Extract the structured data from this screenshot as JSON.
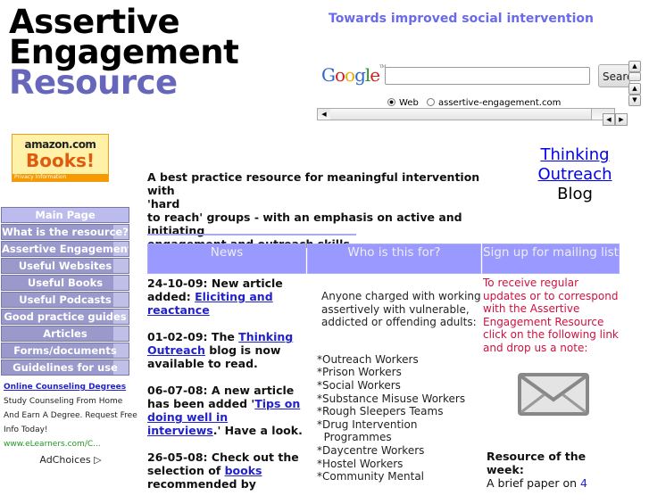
{
  "header": {
    "logo_lines": [
      "Assertive",
      "Engagement",
      "Resource"
    ],
    "tagline": "Towards improved social intervention"
  },
  "search": {
    "brand_letters": [
      "G",
      "o",
      "o",
      "g",
      "l",
      "e"
    ],
    "brand_tm": "TM",
    "input_value": "",
    "button_label": "Search",
    "radio_options": [
      {
        "label": "Web",
        "checked": true
      },
      {
        "label": "assertive-engagement.com",
        "checked": false
      }
    ]
  },
  "amazon_banner": {
    "brand": "amazon.com",
    "headline": "Books!",
    "footer": "Privacy Information"
  },
  "nav": {
    "items": [
      {
        "label": "Main Page"
      },
      {
        "label": "What is the resource?"
      },
      {
        "label": "Assertive Engagement"
      },
      {
        "label": "Useful Websites"
      },
      {
        "label": "Useful Books"
      },
      {
        "label": "Useful Podcasts"
      },
      {
        "label": "Good practice guides"
      },
      {
        "label": "Articles"
      },
      {
        "label": "Forms/documents"
      },
      {
        "label": "Guidelines for use"
      }
    ]
  },
  "ad": {
    "title": "Online Counseling Degrees",
    "body": "Study Counseling From Home And Earn A Degree. Request Free Info Today!",
    "url": "www.eLearners.com/C...",
    "choices_label": "AdChoices",
    "choices_icon": "▷"
  },
  "blog_link": {
    "line1": "Thinking",
    "line2": "Outreach",
    "suffix": "Blog"
  },
  "intro": {
    "line1": "A best practice resource for meaningful intervention with",
    "line2": "'hard",
    "line3": "to reach' groups - with an emphasis on active and initiating",
    "line4": "engagement and outreach skills"
  },
  "columns": {
    "news_header": "News",
    "who_header": "Who is this for?",
    "signup_header": "Sign up for mailing list"
  },
  "news": [
    {
      "prefix": "24-10-09: New article added: ",
      "link": "Eliciting and reactance",
      "suffix": ""
    },
    {
      "prefix": "01-02-09: The ",
      "link": "Thinking Outreach",
      "suffix": " blog is now available to read."
    },
    {
      "prefix": "06-07-08: A new article has been added '",
      "link": "Tips on doing well in interviews",
      "suffix": ".' Have a look."
    },
    {
      "prefix": "26-05-08: Check out the selection of ",
      "link": "books",
      "suffix": " recommended by"
    }
  ],
  "who": {
    "intro": "Anyone charged with working assertively with vulnerable, addicted or offending adults:",
    "roles": [
      "*Outreach Workers",
      "*Prison Workers",
      "*Social Workers",
      "*Substance Misuse Workers",
      "*Rough Sleepers Teams",
      "*Drug Intervention",
      "  Programmes",
      "*Daycentre Workers",
      "*Hostel Workers",
      "*Community Mental"
    ]
  },
  "signup": {
    "text": "To receive regular updates or to correspond with the Assertive Engagement Resource click on the following link and drop us a note:"
  },
  "resource_of_week": {
    "heading": "Resource of the week:",
    "text": "A brief paper on ",
    "link": "4"
  },
  "colors": {
    "accent": "#9999ff",
    "nav_bg": "#9999cc",
    "logo_resource": "#6666bb",
    "tagline": "#6a6aee",
    "signup_text": "#d01040",
    "link": "#2222cc"
  }
}
